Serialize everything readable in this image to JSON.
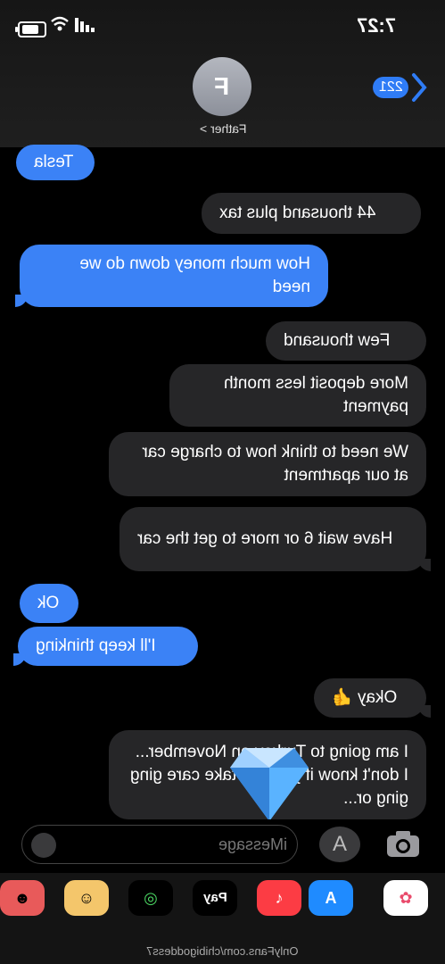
{
  "status": {
    "time": "7:27"
  },
  "header": {
    "back_count": "221",
    "avatar_initial": "F",
    "contact_name": "Father >"
  },
  "messages": [
    {
      "text": "Tesla",
      "side": "sent"
    },
    {
      "text": "44 thousand plus tax",
      "side": "received"
    },
    {
      "text": "How much money down do we need",
      "side": "sent"
    },
    {
      "text": "Few thousand",
      "side": "received"
    },
    {
      "text": "More deposit less month payment",
      "side": "received"
    },
    {
      "text": "We need to think how to charge car at our apartment",
      "side": "received"
    },
    {
      "text": "Have wait 6 or more to get the car",
      "side": "received"
    },
    {
      "text": "Ok",
      "side": "sent"
    },
    {
      "text": "I'll keep thinking",
      "side": "sent"
    },
    {
      "text": "Okay 👍",
      "side": "received"
    },
    {
      "text": "I am going to Turkey on November... I don't know if you can take care ging ging or...",
      "side": "received"
    }
  ],
  "input": {
    "placeholder": "iMessage"
  },
  "apps": [
    {
      "name": "photos-app-icon",
      "label": "✿"
    },
    {
      "name": "app-store-icon",
      "label": "A"
    },
    {
      "name": "music-app-icon",
      "label": "♪"
    },
    {
      "name": "apple-pay-icon",
      "label": "Pay"
    },
    {
      "name": "activity-app-icon",
      "label": "◎"
    },
    {
      "name": "memoji-icon",
      "label": "☺"
    },
    {
      "name": "memoji-stickers-icon",
      "label": "☻"
    }
  ],
  "watermark": "OnlyFans.com/chibigoddess7",
  "colors": {
    "sent": "#3b82f6",
    "received": "#262628",
    "badge": "#2f7cf6"
  }
}
